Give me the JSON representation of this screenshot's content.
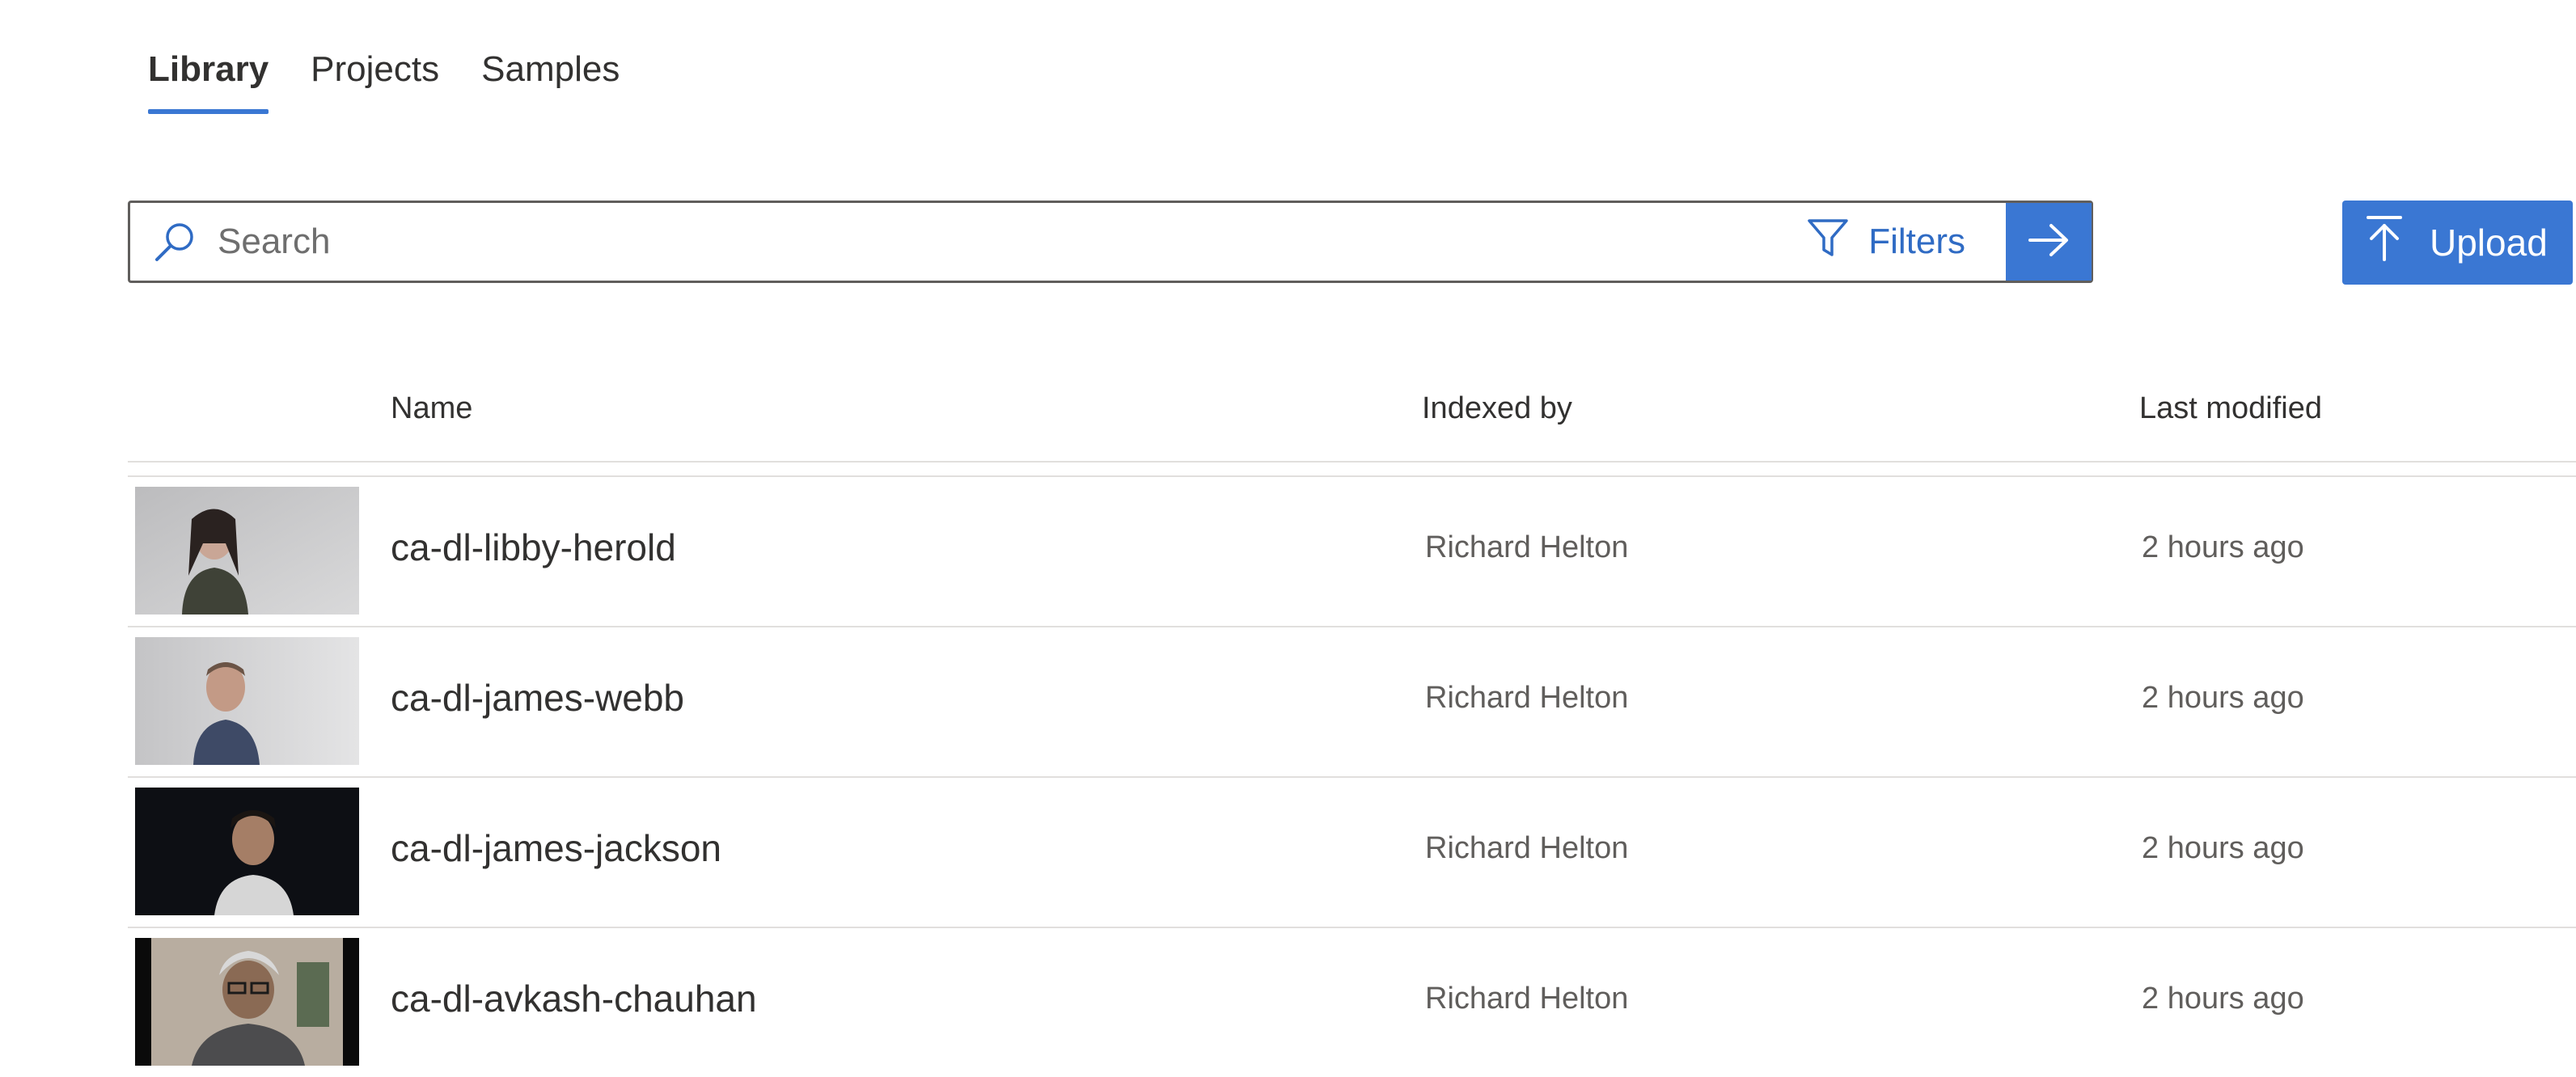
{
  "tabs": [
    {
      "label": "Library",
      "active": true
    },
    {
      "label": "Projects",
      "active": false
    },
    {
      "label": "Samples",
      "active": false
    }
  ],
  "search": {
    "placeholder": "Search",
    "value": "",
    "icon": "search-icon",
    "filters_label": "Filters",
    "filters_icon": "filter-icon",
    "go_icon": "arrow-right-icon"
  },
  "upload": {
    "label": "Upload",
    "icon": "upload-arrow-icon"
  },
  "table": {
    "columns": [
      "Name",
      "Indexed by",
      "Last modified"
    ],
    "rows": [
      {
        "name": "ca-dl-libby-herold",
        "indexed_by": "Richard Helton",
        "modified": "2 hours ago"
      },
      {
        "name": "ca-dl-james-webb",
        "indexed_by": "Richard Helton",
        "modified": "2 hours ago"
      },
      {
        "name": "ca-dl-james-jackson",
        "indexed_by": "Richard Helton",
        "modified": "2 hours ago"
      },
      {
        "name": "ca-dl-avkash-chauhan",
        "indexed_by": "Richard Helton",
        "modified": "2 hours ago"
      }
    ]
  },
  "colors": {
    "accent": "#3a77d3",
    "accent_text": "#2f6bc4",
    "divider": "#e1dfdd",
    "text": "#323130",
    "muted_text": "#605e5c"
  }
}
